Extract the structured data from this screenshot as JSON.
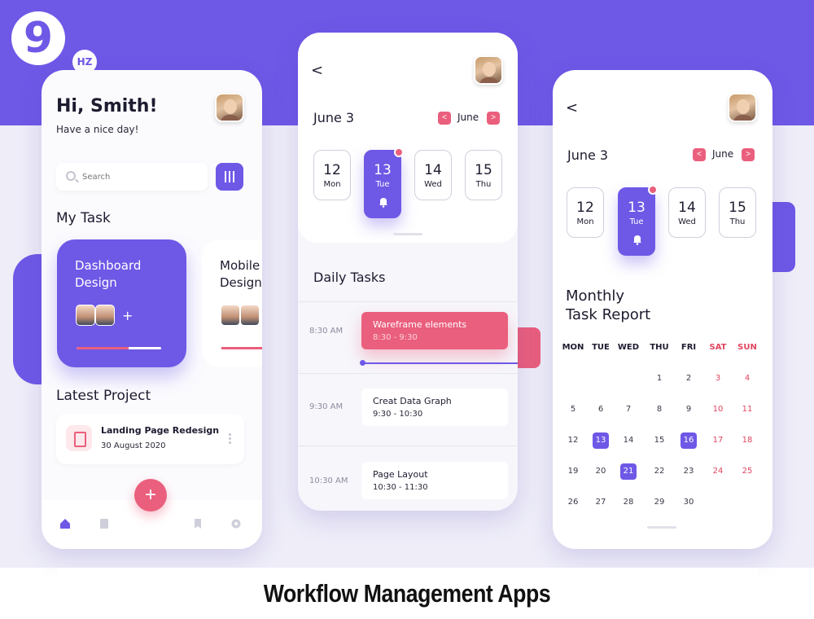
{
  "brand": {
    "logo_text": "9",
    "logo_suffix": "HZ"
  },
  "caption": "Workflow Management Apps",
  "colors": {
    "purple": "#6e58e6",
    "pink": "#ea5f7d",
    "lavender": "#eeedf8"
  },
  "phone1": {
    "greeting": "Hi, Smith!",
    "subtitle": "Have a nice day!",
    "search_placeholder": "Search",
    "my_task_title": "My Task",
    "tasks": [
      {
        "title": "Dashboard Design",
        "progress": 0.62
      },
      {
        "title": "Mobile Design"
      }
    ],
    "add_member": "+",
    "latest_project_title": "Latest Project",
    "project": {
      "title": "Landing Page Redesign",
      "date": "30 August 2020"
    },
    "fab": "+",
    "nav": [
      "home-icon",
      "document-icon",
      "bookmark-icon",
      "gear-icon"
    ]
  },
  "phone2": {
    "back": "<",
    "date": "June 3",
    "month": "June",
    "prev": "<",
    "next": ">",
    "days": [
      {
        "num": "12",
        "dow": "Mon"
      },
      {
        "num": "13",
        "dow": "Tue"
      },
      {
        "num": "14",
        "dow": "Wed"
      },
      {
        "num": "15",
        "dow": "Thu"
      }
    ],
    "daily_tasks_title": "Daily Tasks",
    "slots": [
      {
        "time": "8:30 AM",
        "title": "Wareframe elements",
        "range": "8:30 - 9:30"
      },
      {
        "time": "9:30 AM",
        "title": "Creat Data Graph",
        "range": "9:30 - 10:30"
      },
      {
        "time": "10:30 AM",
        "title": "Page Layout",
        "range": "10:30 - 11:30"
      }
    ]
  },
  "phone3": {
    "back": "<",
    "date": "June 3",
    "month": "June",
    "prev": "<",
    "next": ">",
    "days": [
      {
        "num": "12",
        "dow": "Mon"
      },
      {
        "num": "13",
        "dow": "Tue"
      },
      {
        "num": "14",
        "dow": "Wed"
      },
      {
        "num": "15",
        "dow": "Thu"
      }
    ],
    "report_line1": "Monthly",
    "report_line2": "Task Report",
    "weekdays": [
      "MON",
      "TUE",
      "WED",
      "THU",
      "FRI",
      "SAT",
      "SUN"
    ],
    "weeks": [
      [
        "",
        "",
        "",
        "1",
        "2",
        "3",
        "4"
      ],
      [
        "5",
        "6",
        "7",
        "8",
        "9",
        "10",
        "11"
      ],
      [
        "12",
        "13",
        "14",
        "15",
        "16",
        "17",
        "18"
      ],
      [
        "19",
        "20",
        "21",
        "22",
        "23",
        "24",
        "25"
      ],
      [
        "26",
        "27",
        "28",
        "29",
        "30",
        "",
        ""
      ]
    ],
    "selected": [
      "13",
      "16",
      "21"
    ]
  }
}
